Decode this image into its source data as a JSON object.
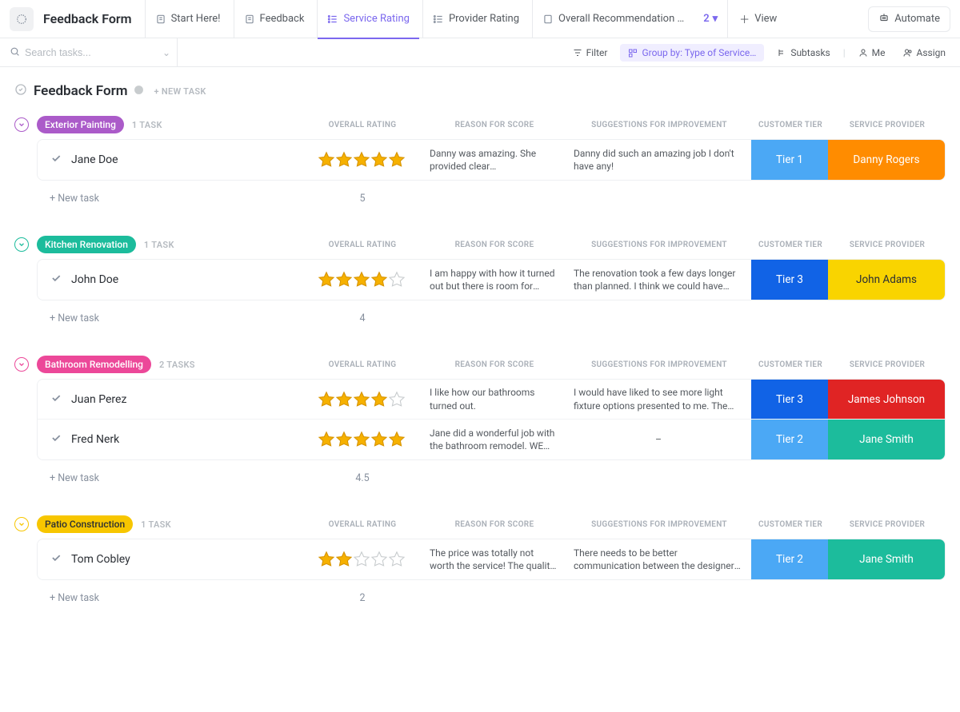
{
  "page": {
    "title": "Feedback Form"
  },
  "tabs": [
    {
      "label": "Start Here!"
    },
    {
      "label": "Feedback"
    },
    {
      "label": "Service Rating",
      "active": true
    },
    {
      "label": "Provider Rating"
    },
    {
      "label": "Overall Recommendation …"
    }
  ],
  "tabs_extra": {
    "count": "2"
  },
  "view_button": "View",
  "automate_button": "Automate",
  "search": {
    "placeholder": "Search tasks..."
  },
  "toolbar": {
    "filter": "Filter",
    "group_by": "Group by: Type of Service…",
    "subtasks": "Subtasks",
    "me": "Me",
    "assign": "Assign"
  },
  "board_header": {
    "title": "Feedback Form",
    "new_task": "+ NEW TASK"
  },
  "columns": {
    "rating": "OVERALL RATING",
    "reason": "REASON FOR SCORE",
    "sugg": "SUGGESTIONS FOR IMPROVEMENT",
    "tier": "CUSTOMER TIER",
    "prov": "SERVICE PROVIDER"
  },
  "new_task_row": "+ New task",
  "groups": [
    {
      "id": "exterior-painting",
      "name": "Exterior Painting",
      "badge_class": "bg-purple",
      "ring_class": "ring-purple",
      "count_label": "1 TASK",
      "avg": "5",
      "rows": [
        {
          "name": "Jane Doe",
          "stars": 5,
          "reason": "Danny was amazing. She provided clear communication of time…",
          "sugg": "Danny did such an amazing job I don't have any!",
          "tier": {
            "label": "Tier 1",
            "class": "bg-lblue"
          },
          "prov": {
            "label": "Danny Rogers",
            "class": "bg-orange"
          }
        }
      ]
    },
    {
      "id": "kitchen-renovation",
      "name": "Kitchen Renovation",
      "badge_class": "bg-teal",
      "ring_class": "ring-teal",
      "count_label": "1 TASK",
      "avg": "4",
      "rows": [
        {
          "name": "John Doe",
          "stars": 4,
          "reason": "I am happy with how it turned out but there is room for improvement",
          "sugg": "The renovation took a few days longer than planned. I think we could have finished on …",
          "tier": {
            "label": "Tier 3",
            "class": "bg-blue"
          },
          "prov": {
            "label": "John Adams",
            "class": "bg-gold"
          }
        }
      ]
    },
    {
      "id": "bathroom-remodelling",
      "name": "Bathroom Remodelling",
      "badge_class": "bg-pink",
      "ring_class": "ring-pink",
      "count_label": "2 TASKS",
      "avg": "4.5",
      "rows": [
        {
          "name": "Juan Perez",
          "stars": 4,
          "reason": "I like how our bathrooms turned out.",
          "sugg": "I would have liked to see more light fixture options presented to me. The options provided…",
          "tier": {
            "label": "Tier 3",
            "class": "bg-blue"
          },
          "prov": {
            "label": "James Johnson",
            "class": "bg-red"
          }
        },
        {
          "name": "Fred Nerk",
          "stars": 5,
          "reason": "Jane did a wonderful job with the bathroom remodel. WE LOVE IT!",
          "sugg": "–",
          "tier": {
            "label": "Tier 2",
            "class": "bg-lblue"
          },
          "prov": {
            "label": "Jane Smith",
            "class": "bg-green"
          }
        }
      ]
    },
    {
      "id": "patio-construction",
      "name": "Patio Construction",
      "badge_class": "bg-yellow",
      "ring_class": "ring-yellow",
      "count_label": "1 TASK",
      "avg": "2",
      "rows": [
        {
          "name": "Tom Cobley",
          "stars": 2,
          "reason": "The price was totally not worth the service! The quality of work …",
          "sugg": "There needs to be better communication between the designer and the people doing the…",
          "tier": {
            "label": "Tier 2",
            "class": "bg-lblue"
          },
          "prov": {
            "label": "Jane Smith",
            "class": "bg-green"
          }
        }
      ]
    }
  ]
}
